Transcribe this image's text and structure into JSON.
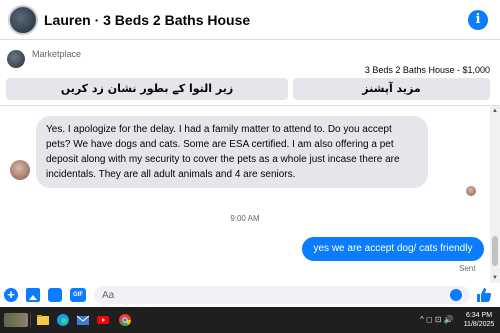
{
  "header": {
    "title": "Lauren · 3 Beds 2 Baths House",
    "info_icon": "info-icon",
    "info_glyph": "i",
    "accent": "#0a7cff"
  },
  "marketplace": {
    "label": "Marketplace",
    "listing": "3 Beds 2 Baths House - $1,000",
    "buttons": [
      {
        "label": "زیر التوا کے بطور نشان زد کریں"
      },
      {
        "label": "مزید آپشنز"
      }
    ]
  },
  "messages": [
    {
      "direction": "incoming",
      "text": "Yes. I apologize for the delay. I had a family matter to attend to. Do you accept pets? We have dogs and cats. Some are ESA certified. I am also offering a pet deposit along with my security to cover the pets as a whole just incase there are incidentals. They are all adult animals and 4 are seniors."
    },
    {
      "direction": "divider",
      "text": "9:00 AM"
    },
    {
      "direction": "outgoing",
      "text": "yes we are accept dog/ cats friendly",
      "status": "Sent"
    }
  ],
  "composer": {
    "value": "Aa",
    "icons": [
      "plus-icon",
      "photo-icon",
      "sticker-icon",
      "gif-icon",
      "emoji-icon",
      "like-icon"
    ],
    "gif_label": "GIF",
    "plus_glyph": "+"
  },
  "taskbar": {
    "time": "6:34 PM",
    "date": "11/8/2025",
    "tray": "^ ◻ ⊡ 🔊"
  }
}
